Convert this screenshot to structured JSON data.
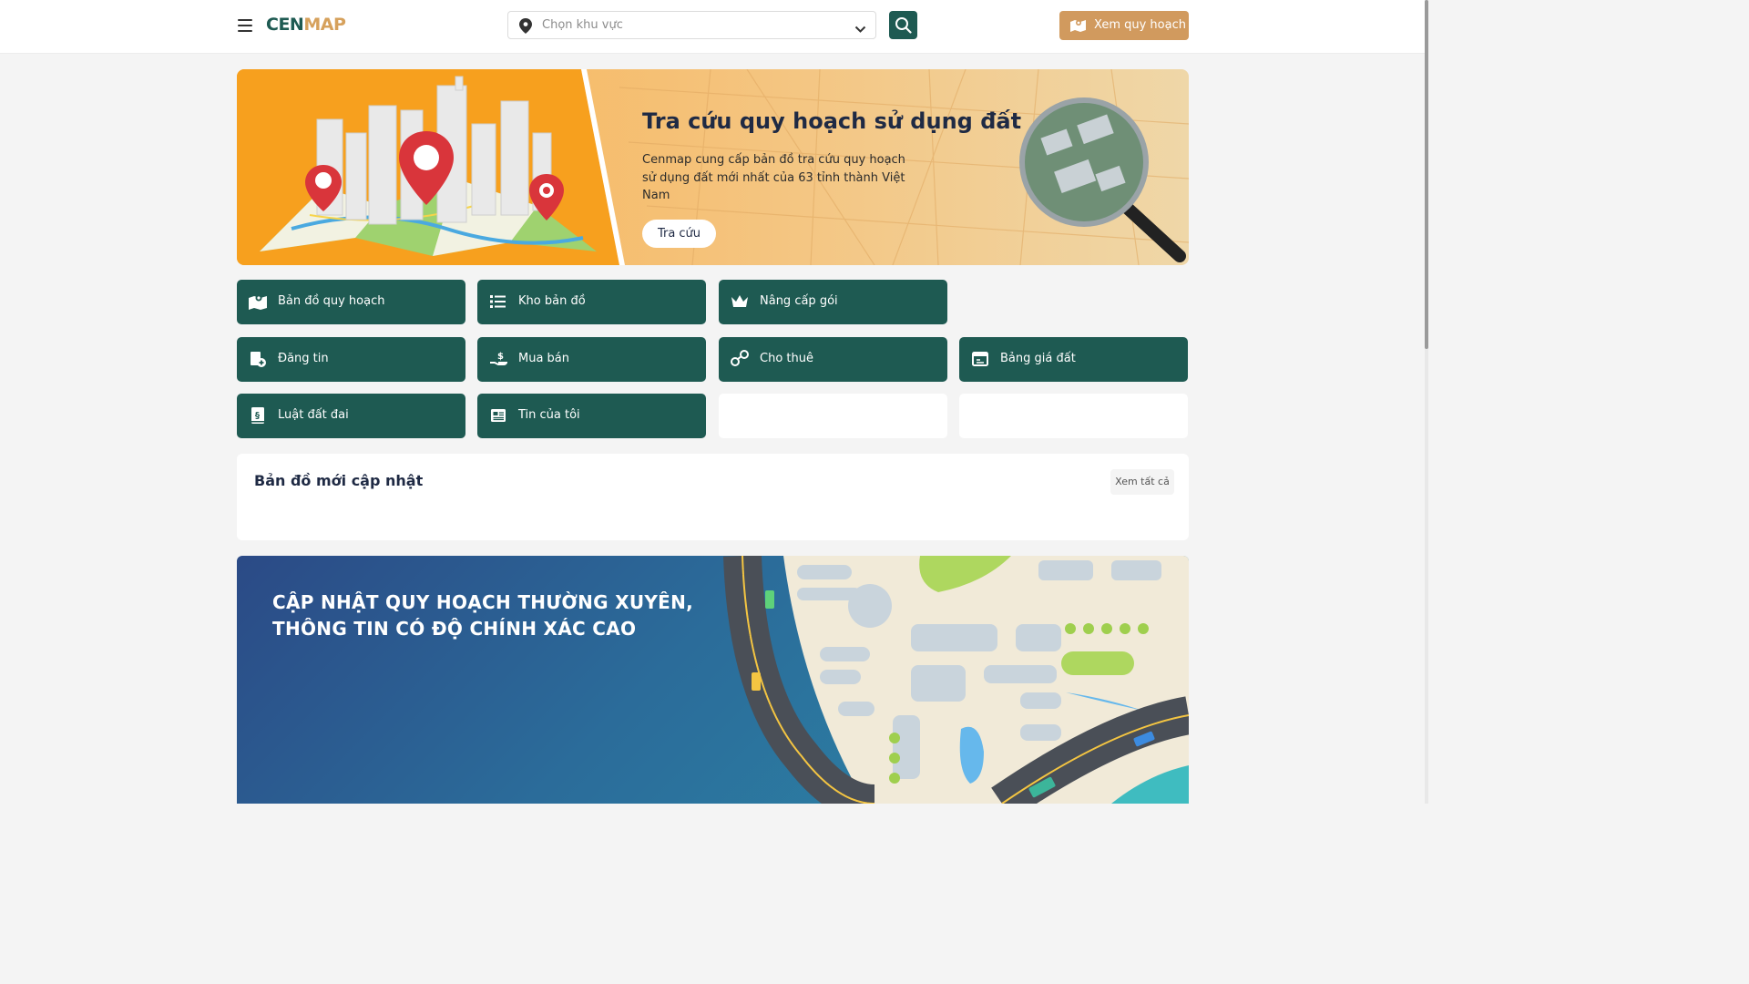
{
  "header": {
    "logo": {
      "part1": "CEN",
      "part2": "MAP"
    },
    "region_select": {
      "placeholder": "Chọn khu vực"
    },
    "plan_button": "Xem quy hoạch"
  },
  "hero": {
    "title": "Tra cứu quy hoạch sử dụng đất",
    "description": "Cenmap cung cấp bản đồ tra cứu quy hoạch sử dụng đất mới nhất của 63 tỉnh thành Việt Nam",
    "button": "Tra cứu"
  },
  "menu": [
    {
      "label": "Bản đồ quy hoạch",
      "icon": "map-icon"
    },
    {
      "label": "Kho bản đồ",
      "icon": "list-icon"
    },
    {
      "label": "Nâng cấp gói",
      "icon": "crown-icon"
    },
    {
      "label": "Đăng tin",
      "icon": "post-icon"
    },
    {
      "label": "Mua bán",
      "icon": "hand-money-icon"
    },
    {
      "label": "Cho thuê",
      "icon": "people-icon"
    },
    {
      "label": "Bảng giá đất",
      "icon": "price-table-icon"
    },
    {
      "label": "Luật đất đai",
      "icon": "law-book-icon"
    },
    {
      "label": "Tin của tôi",
      "icon": "news-icon"
    }
  ],
  "updated_maps": {
    "title": "Bản đồ mới cập nhật",
    "see_all": "Xem tất cả"
  },
  "promo": {
    "line1": "CẬP NHẬT QUY HOẠCH THƯỜNG XUYÊN,",
    "line2": "THÔNG TIN CÓ ĐỘ CHÍNH XÁC CAO"
  },
  "colors": {
    "primary": "#1e5a52",
    "accent": "#d19a5e",
    "hero_orange": "#f7a01e"
  }
}
